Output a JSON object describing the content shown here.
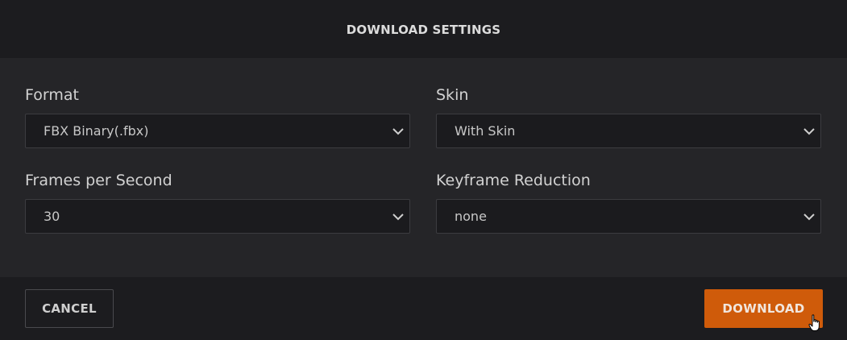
{
  "dialog": {
    "title": "DOWNLOAD SETTINGS"
  },
  "fields": {
    "format": {
      "label": "Format",
      "value": "FBX Binary(.fbx)"
    },
    "skin": {
      "label": "Skin",
      "value": "With Skin"
    },
    "fps": {
      "label": "Frames per Second",
      "value": "30"
    },
    "keyframe_reduction": {
      "label": "Keyframe Reduction",
      "value": "none"
    }
  },
  "footer": {
    "cancel_label": "CANCEL",
    "download_label": "DOWNLOAD"
  },
  "colors": {
    "accent": "#cf5b0a",
    "background": "#1d1d20",
    "panel": "#252528"
  },
  "icons": {
    "select_arrow": "chevron-down-icon",
    "pointer": "hand-pointer-icon"
  }
}
